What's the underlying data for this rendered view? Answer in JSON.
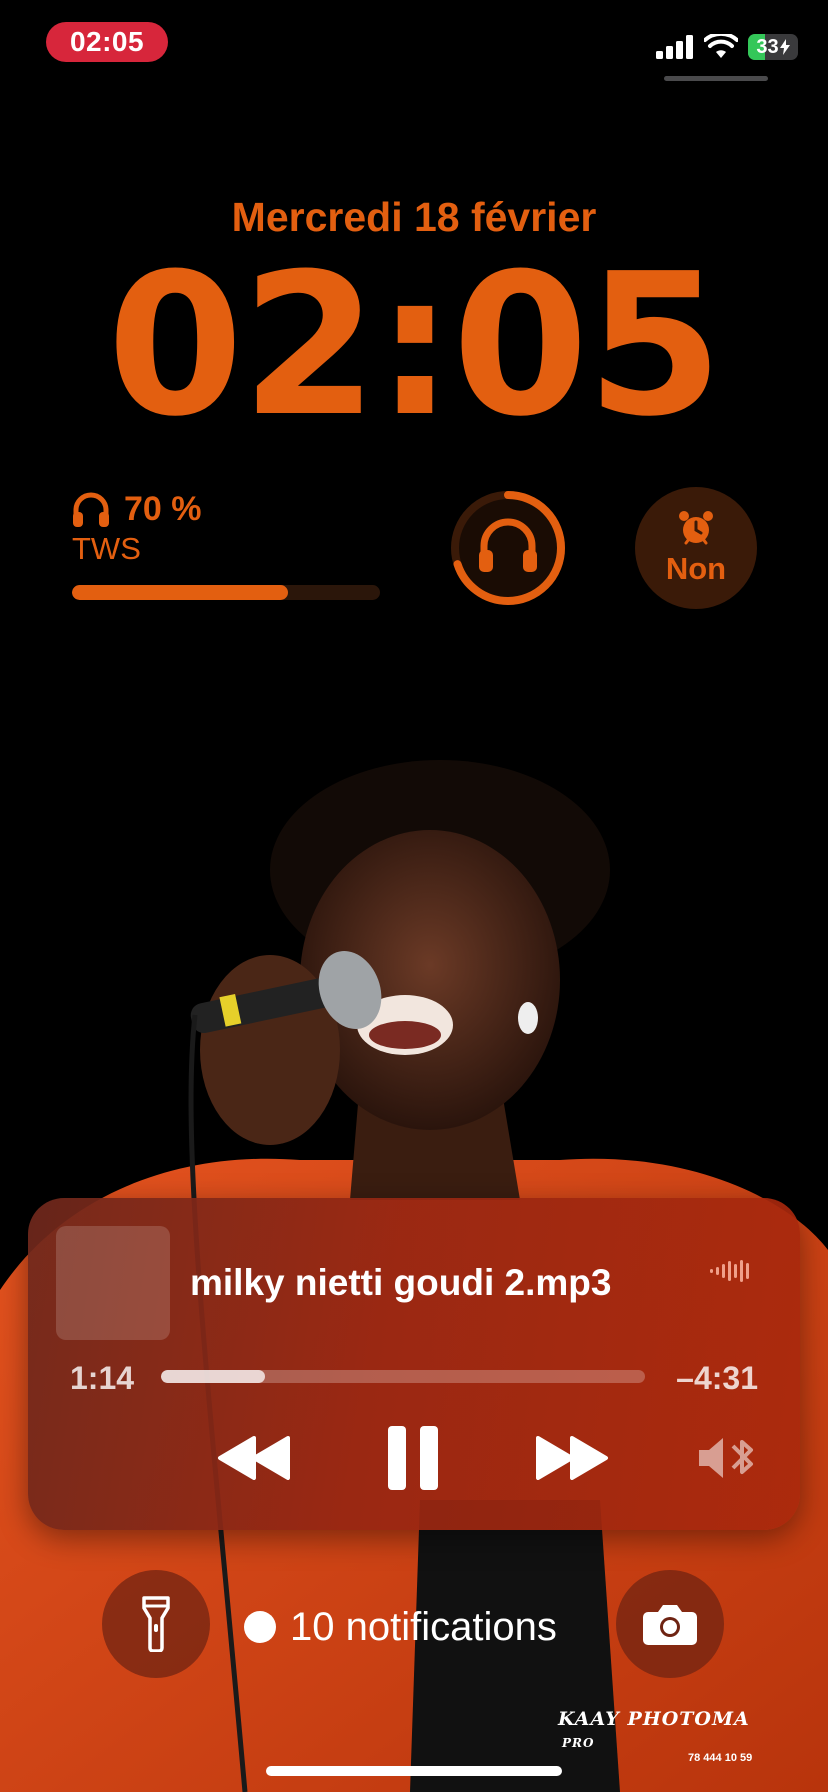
{
  "status_bar": {
    "time": "02:05",
    "battery_level": "33",
    "battery_fraction": 0.33,
    "icons": [
      "cellular-signal-icon",
      "wifi-icon",
      "battery-charging-icon"
    ]
  },
  "lock_screen": {
    "date": "Mercredi 18 février",
    "clock": "02:05"
  },
  "widgets": {
    "headphone_battery": {
      "percent_label": "70 %",
      "percent": 70,
      "device": "TWS"
    },
    "headphone_ring_percent": 70,
    "alarm": {
      "label": "Non"
    }
  },
  "now_playing": {
    "title": "milky nietti goudi 2.mp3",
    "elapsed": "1:14",
    "remaining": "–4:31",
    "progress_fraction": 0.214
  },
  "bottom": {
    "notifications": "10 notifications"
  },
  "watermark": {
    "brand": "KAAY PHOTOMA",
    "suffix": "PRO",
    "phone": "78 444 10 59"
  },
  "colors": {
    "accent": "#e35f10",
    "status_pill": "#d7263b",
    "battery_green": "#34c759"
  }
}
